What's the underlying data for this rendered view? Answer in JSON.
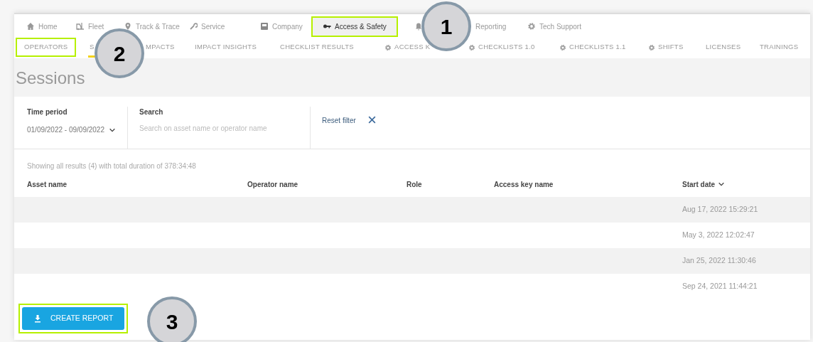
{
  "top_nav": [
    {
      "label": "Home",
      "selected": false,
      "highlighted": false
    },
    {
      "label": "Fleet",
      "selected": false,
      "highlighted": false
    },
    {
      "label": "Track & Trace",
      "selected": false,
      "highlighted": false
    },
    {
      "label": "Service",
      "selected": false,
      "highlighted": false
    },
    {
      "label": "Company",
      "selected": false,
      "highlighted": false
    },
    {
      "label": "Access & Safety",
      "selected": true,
      "highlighted": true
    },
    {
      "selected": false,
      "highlighted": false
    },
    {
      "label": "Reporting",
      "selected": false,
      "highlighted": false
    },
    {
      "label": "Tech Support",
      "selected": false,
      "highlighted": false
    }
  ],
  "sub_nav": [
    {
      "label": "OPERATORS",
      "selected": false,
      "highlighted": true
    },
    {
      "label": "S",
      "selected": true,
      "highlighted": false
    },
    {
      "label": "MPACTS",
      "selected": false,
      "highlighted": false
    },
    {
      "label": "IMPACT INSIGHTS",
      "selected": false,
      "highlighted": false
    },
    {
      "label": "CHECKLIST RESULTS",
      "selected": false,
      "highlighted": false
    }
  ],
  "sub_nav_settings": [
    {
      "label": "ACCESS K",
      "selected": false
    },
    {
      "label": "CHECKLISTS 1.0",
      "selected": false
    },
    {
      "label": "CHECKLISTS 1.1",
      "selected": false
    },
    {
      "label": "SHIFTS",
      "selected": false
    }
  ],
  "sub_nav_more": [
    {
      "label": "LICENSES",
      "selected": false
    },
    {
      "label": "TRAININGS",
      "selected": false
    }
  ],
  "page_title": "Sessions",
  "filters": {
    "time_period": {
      "label": "Time period",
      "value": "01/09/2022 - 09/09/2022"
    },
    "search": {
      "label": "Search",
      "placeholder": "Search on asset name or operator name"
    },
    "reset": "Reset filter"
  },
  "summary": "Showing all results (4) with total duration of 378:34:48",
  "table": {
    "columns": [
      {
        "label": "Asset name",
        "sorted": false
      },
      {
        "label": "Operator name",
        "sorted": false
      },
      {
        "label": "Role",
        "sorted": false
      },
      {
        "label": "Access key name",
        "sorted": false
      },
      {
        "label": "Start date",
        "sorted": true
      }
    ],
    "rows": [
      {
        "start_date": "Aug 17, 2022 15:29:21"
      },
      {
        "start_date": "May 3, 2022 12:02:47"
      },
      {
        "start_date": "Jan 25, 2022 11:30:46"
      },
      {
        "start_date": "Sep 24, 2021 11:44:21"
      }
    ]
  },
  "create_report": {
    "label": "CREATE REPORT",
    "highlighted": true
  },
  "callouts": [
    {
      "number": "1"
    },
    {
      "number": "2"
    },
    {
      "number": "3"
    }
  ]
}
